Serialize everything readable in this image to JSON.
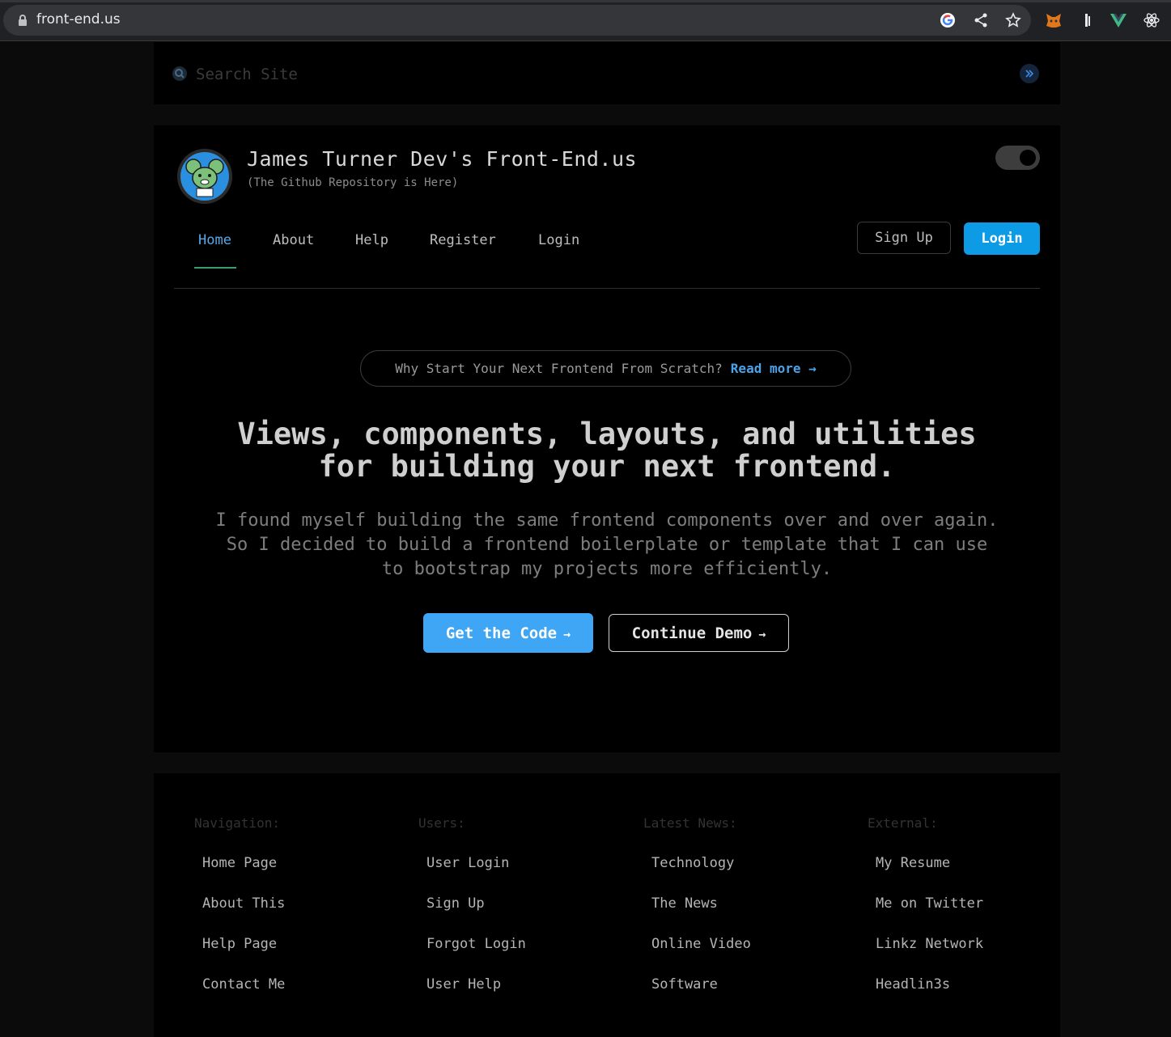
{
  "browser": {
    "url": "front-end.us"
  },
  "search": {
    "placeholder": "Search Site"
  },
  "header": {
    "title": "James Turner Dev's Front-End.us",
    "subtitle": "(The Github Repository is Here)"
  },
  "nav": {
    "tabs": [
      {
        "label": "Home",
        "active": true
      },
      {
        "label": "About"
      },
      {
        "label": "Help"
      },
      {
        "label": "Register"
      },
      {
        "label": "Login"
      }
    ],
    "signup_label": "Sign Up",
    "login_label": "Login"
  },
  "hero": {
    "announce_text": "Why Start Your Next Frontend From Scratch?",
    "announce_link": "Read more",
    "heading_line1": "Views, components, layouts, and utilities",
    "heading_line2": "for building your next frontend.",
    "body": "I found myself building the same frontend components over and over again. So I decided to build a frontend boilerplate or template that I can use to bootstrap my projects more efficiently.",
    "primary_label": "Get the Code",
    "secondary_label": "Continue Demo"
  },
  "footer": {
    "columns": [
      {
        "heading": "Navigation:",
        "links": [
          "Home Page",
          "About This",
          "Help Page",
          "Contact Me"
        ]
      },
      {
        "heading": "Users:",
        "links": [
          "User Login",
          "Sign Up",
          "Forgot Login",
          "User Help"
        ]
      },
      {
        "heading": "Latest News:",
        "links": [
          "Technology",
          "The News",
          "Online Video",
          "Software"
        ]
      },
      {
        "heading": "External:",
        "links": [
          "My Resume",
          "Me on Twitter",
          "Linkz Network",
          "Headlin3s"
        ]
      }
    ]
  },
  "colors": {
    "accent": "#0d9be6",
    "primary_button": "#3ea6f5",
    "active_tab": "#5aa9e6",
    "tab_underline": "#3b9e6e"
  }
}
